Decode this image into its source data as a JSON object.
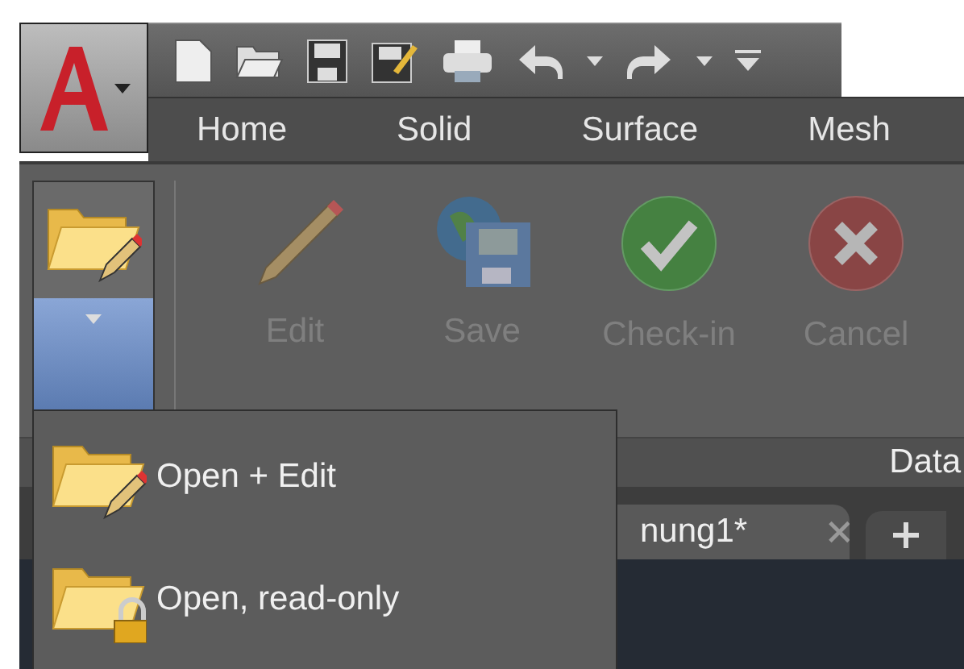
{
  "ribbon_tabs": [
    {
      "label": "Home"
    },
    {
      "label": "Solid"
    },
    {
      "label": "Surface"
    },
    {
      "label": "Mesh"
    }
  ],
  "ribbon_buttons": [
    {
      "kind": "edit",
      "label": "Edit",
      "disabled": true
    },
    {
      "kind": "save",
      "label": "Save",
      "disabled": true
    },
    {
      "kind": "checkin",
      "label": "Check-in",
      "disabled": true
    },
    {
      "kind": "cancel",
      "label": "Cancel",
      "disabled": true
    }
  ],
  "panel_title": "Data",
  "document_tab": {
    "label": "nung1*"
  },
  "open_menu": {
    "expanded": true,
    "items": [
      {
        "kind": "edit",
        "label": "Open + Edit"
      },
      {
        "kind": "readonly",
        "label": "Open, read-only"
      }
    ]
  }
}
